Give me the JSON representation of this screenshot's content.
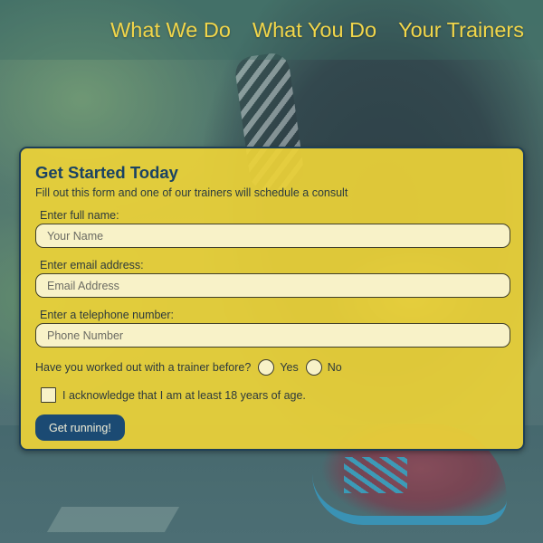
{
  "nav": {
    "links": [
      {
        "label": "What We Do"
      },
      {
        "label": "What You Do"
      },
      {
        "label": "Your Trainers"
      }
    ]
  },
  "form": {
    "title": "Get Started Today",
    "subtitle": "Fill out this form and one of our trainers will schedule a consult",
    "fields": [
      {
        "label": "Enter full name:",
        "placeholder": "Your Name",
        "value": ""
      },
      {
        "label": "Enter email address:",
        "placeholder": "Email Address",
        "value": ""
      },
      {
        "label": "Enter a telephone number:",
        "placeholder": "Phone Number",
        "value": ""
      }
    ],
    "trainer_question": "Have you worked out with a trainer before?",
    "radio_options": [
      {
        "label": "Yes",
        "selected": false
      },
      {
        "label": "No",
        "selected": false
      }
    ],
    "age_ack": {
      "label": "I acknowledge that I am at least 18 years of age.",
      "checked": false
    },
    "submit_label": "Get running!"
  },
  "colors": {
    "nav_text": "#f2d64a",
    "card_background": "#ecd238",
    "title": "#1b4363",
    "button": "#1b4a73",
    "input_background": "#f8f2c8"
  }
}
